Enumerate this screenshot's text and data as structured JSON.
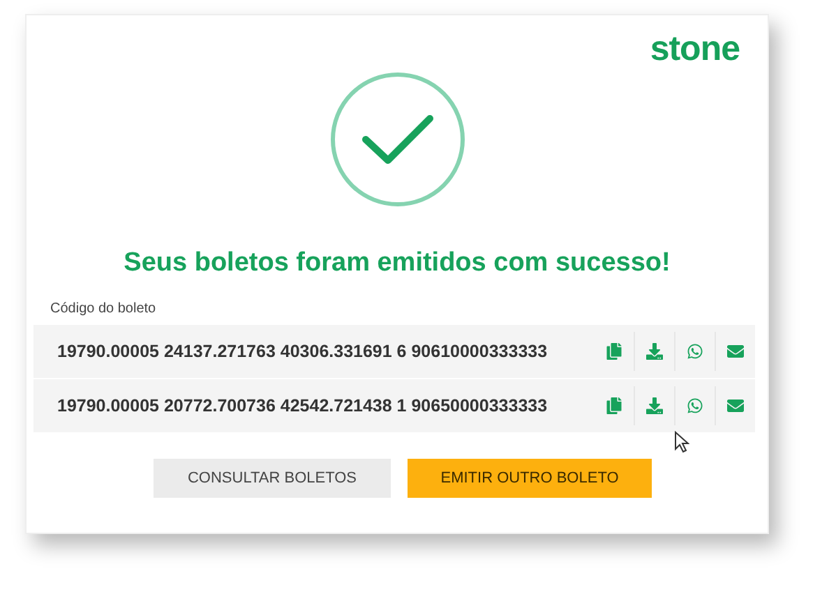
{
  "logo": "stone",
  "title": "Seus boletos foram emitidos com sucesso!",
  "code_label": "Código do boleto",
  "boletos": [
    {
      "code": "19790.00005 24137.271763 40306.331691 6 90610000333333"
    },
    {
      "code": "19790.00005 20772.700736 42542.721438 1 90650000333333"
    }
  ],
  "buttons": [
    {
      "label": "CONSULTAR BOLETOS",
      "kind": "secondary"
    },
    {
      "label": "EMITIR OUTRO BOLETO",
      "kind": "primary"
    }
  ]
}
